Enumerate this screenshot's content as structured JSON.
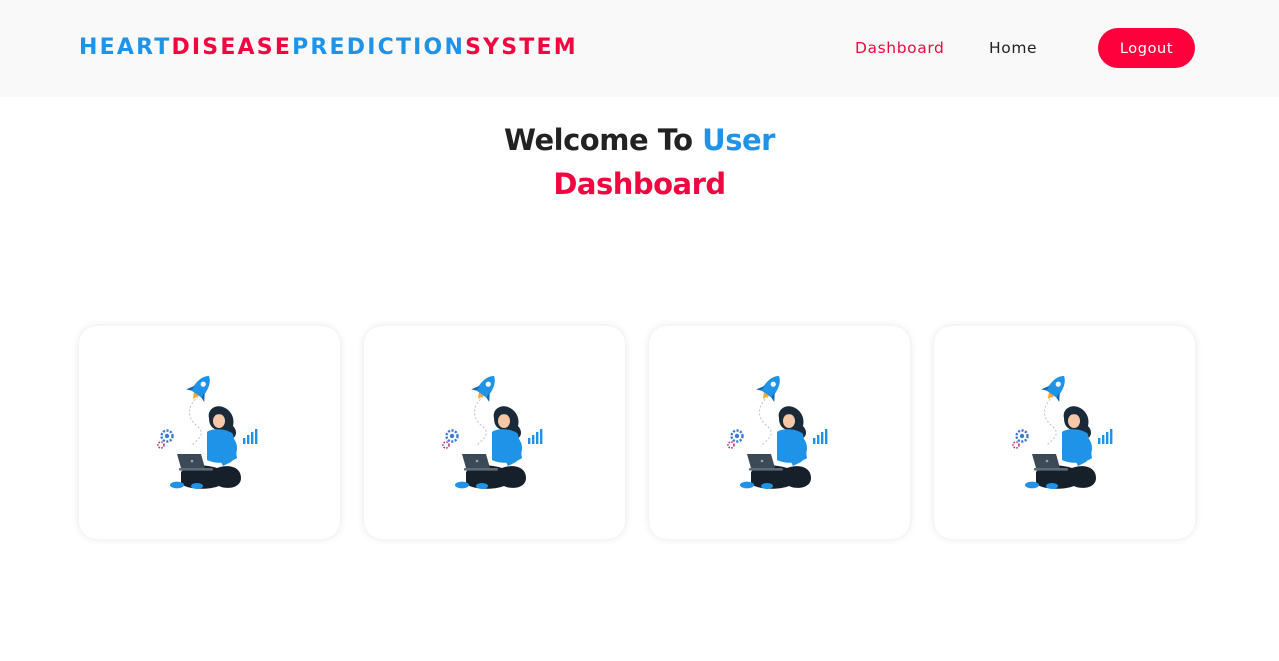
{
  "brand": {
    "part1": "HEART",
    "part2": "DISEASE",
    "part3": "PREDICTION",
    "part4": "SYSTEM"
  },
  "nav": {
    "dashboard": "Dashboard",
    "home": "Home",
    "logout": "Logout"
  },
  "welcome": {
    "prefix": "Welcome To ",
    "highlight": "User",
    "line2": "Dashboard"
  },
  "cards": [
    {
      "illustration": "woman-laptop-rocket-illustration"
    },
    {
      "illustration": "woman-laptop-rocket-illustration"
    },
    {
      "illustration": "woman-laptop-rocket-illustration"
    },
    {
      "illustration": "woman-laptop-rocket-illustration"
    }
  ],
  "colors": {
    "accent_blue": "#1f93e8",
    "accent_red": "#f2063f",
    "logout_bg": "#ff003c",
    "navbar_bg": "#f9f9f9"
  }
}
